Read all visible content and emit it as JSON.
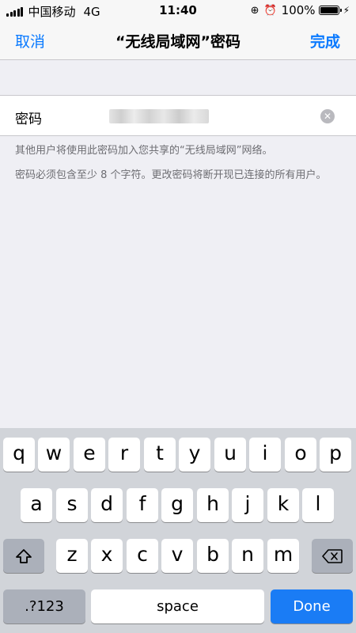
{
  "status_bar": {
    "carrier": "中国移动",
    "network": "4G",
    "time": "11:40",
    "battery": "100%",
    "icons": [
      "signal-icon",
      "rotation-lock-icon",
      "alarm-icon",
      "battery-icon",
      "charging-icon"
    ]
  },
  "nav": {
    "cancel_label": "取消",
    "title": "“无线局域网”密码",
    "done_label": "完成"
  },
  "password_row": {
    "label": "密码",
    "value_state": "blurred"
  },
  "notes": {
    "share_note": "其他用户将使用此密码加入您共享的“无线局域网”网络。",
    "requirement_note": "密码必须包含至少 8 个字符。更改密码将断开现已连接的所有用户。"
  },
  "keyboard": {
    "row1": [
      "q",
      "w",
      "e",
      "r",
      "t",
      "y",
      "u",
      "i",
      "o",
      "p"
    ],
    "row2": [
      "a",
      "s",
      "d",
      "f",
      "g",
      "h",
      "j",
      "k",
      "l"
    ],
    "row3": [
      "z",
      "x",
      "c",
      "v",
      "b",
      "n",
      "m"
    ],
    "numbers_label": ".?123",
    "space_label": "space",
    "done_label": "Done"
  },
  "colors": {
    "accent": "#0a7aff",
    "done_key": "#1a7cf5",
    "background": "#efeff4",
    "keyboard": "#d1d4d9"
  }
}
